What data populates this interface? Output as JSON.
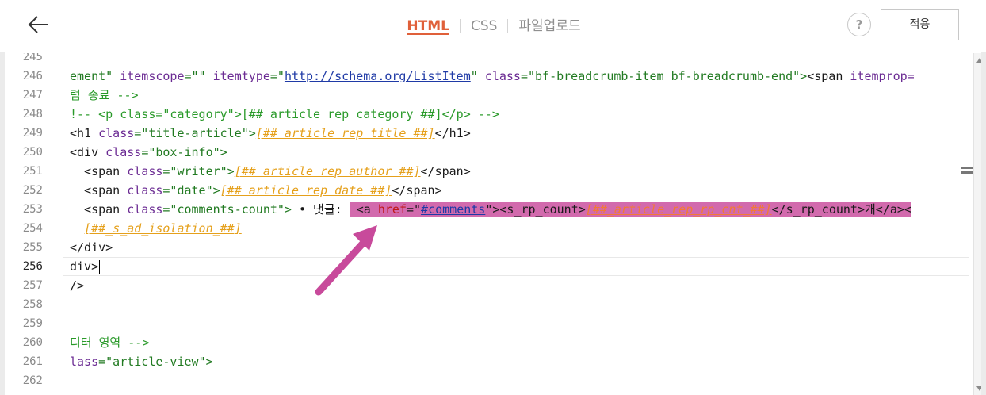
{
  "header": {
    "tabs": [
      {
        "label": "HTML",
        "active": true
      },
      {
        "label": "CSS",
        "active": false
      },
      {
        "label": "파일업로드",
        "active": false
      }
    ],
    "help_label": "?",
    "apply_label": "적용",
    "back_icon": "arrow-left-icon"
  },
  "colors": {
    "accent": "#e0603a",
    "selection": "#d26aad",
    "annotation_arrow": "#c84a9b",
    "tag": "#1a1a1a",
    "attribute": "#6b2b93",
    "string": "#217a21",
    "comment": "#2a9a2a",
    "template_variable": "#e5a01b"
  },
  "editor": {
    "line_numbers": [
      "245",
      "246",
      "247",
      "248",
      "249",
      "250",
      "251",
      "252",
      "253",
      "254",
      "255",
      "256",
      "257",
      "258",
      "259",
      "260",
      "261",
      "262"
    ],
    "active_line": "256",
    "lines": {
      "l246": {
        "p1": "ement\" ",
        "p2": "itemscope",
        "p3": "=\"\" ",
        "p4": "itemtype",
        "p5": "=\"",
        "p6": "http://schema.org/ListItem",
        "p7": "\" ",
        "p8": "class",
        "p9": "=\"bf-breadcrumb-item bf-breadcrumb-end\">",
        "p10": "<span ",
        "p11": "itemprop="
      },
      "l247": {
        "p1": "럼 종료 -->"
      },
      "l248": {
        "p1": "!-- <p class=\"category\">[##_article_rep_category_##]</p> -->"
      },
      "l249": {
        "p1": "<h1 ",
        "p2": "class",
        "p3": "=\"title-article\">",
        "p4": "[##_article_rep_title_##]",
        "p5": "</h1>"
      },
      "l250": {
        "p1": "<div ",
        "p2": "class",
        "p3": "=\"box-info\">"
      },
      "l251": {
        "p1": "  <span ",
        "p2": "class",
        "p3": "=\"writer\">",
        "p4": "[##_article_rep_author_##]",
        "p5": "</span>"
      },
      "l252": {
        "p1": "  <span ",
        "p2": "class",
        "p3": "=\"date\">",
        "p4": "[##_article_rep_date_##]",
        "p5": "</span>"
      },
      "l253": {
        "p1": "  <span ",
        "p2": "class",
        "p3": "=\"comments-count\">",
        "p4": " • 댓글: ",
        "p5": " <a ",
        "p6": "href",
        "p7": "=\"",
        "p8": "#comments",
        "p9": "\">",
        "p10": "<s_rp_count>",
        "p11": "[##_article_rep_rp_cnt_##]",
        "p12": "</s_rp_count>",
        "p13": "개</a><"
      },
      "l254": {
        "p1": "  ",
        "p2": "[##_s_ad_isolation_##]"
      },
      "l255": {
        "p1": "</div>"
      },
      "l256": {
        "p1": "div>"
      },
      "l257": {
        "p1": "/>"
      },
      "l258": {
        "p1": ""
      },
      "l259": {
        "p1": ""
      },
      "l260": {
        "p1": "디터 영역 -->"
      },
      "l261": {
        "p1": "lass",
        "p2": "=\"article-view\">"
      },
      "l262": {
        "p1": ""
      }
    }
  }
}
